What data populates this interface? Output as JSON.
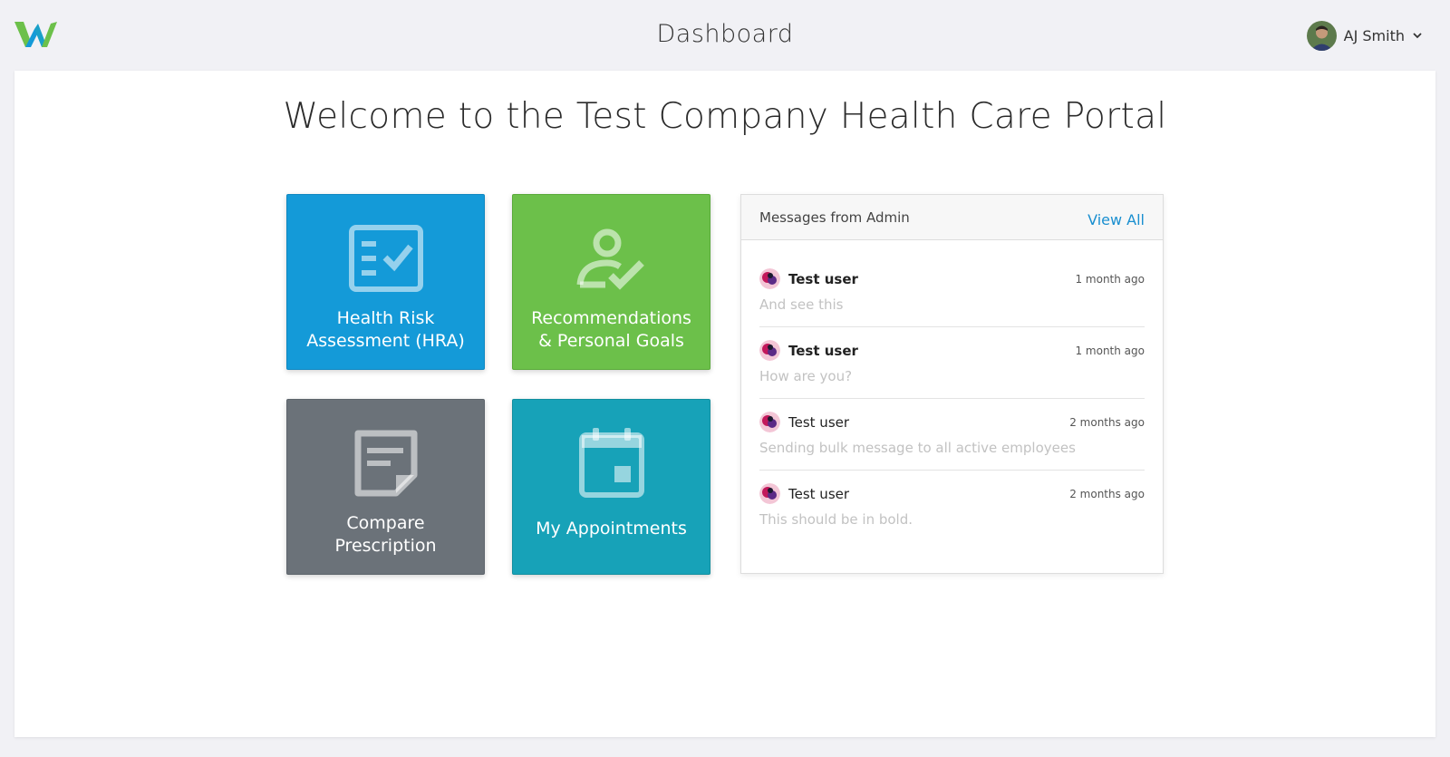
{
  "header": {
    "title": "Dashboard",
    "user_name": "AJ Smith",
    "logo_icon": "w-logo-icon",
    "brand_colors": {
      "green": "#6cc04a",
      "blue": "#149ad8"
    }
  },
  "main": {
    "welcome": "Welcome to the Test Company Health Care Portal",
    "tiles": [
      {
        "label_line1": "Health Risk",
        "label_line2": "Assessment (HRA)",
        "icon": "checklist-icon",
        "color": "#149ad8"
      },
      {
        "label_line1": "Recommendations",
        "label_line2": "& Personal Goals",
        "icon": "user-check-icon",
        "color": "#6cc04a"
      },
      {
        "label_line1": "Compare",
        "label_line2": "Prescription",
        "icon": "document-icon",
        "color": "#6b7279"
      },
      {
        "label_line1": "My Appointments",
        "icon": "calendar-icon",
        "color": "#17a2b8"
      }
    ]
  },
  "messages": {
    "title": "Messages from Admin",
    "view_all": "View All",
    "items": [
      {
        "user": "Test user",
        "time": "1 month ago",
        "preview": "And see this",
        "unread": true
      },
      {
        "user": "Test user",
        "time": "1 month ago",
        "preview": "How are you?",
        "unread": true
      },
      {
        "user": "Test user",
        "time": "2 months ago",
        "preview": "Sending bulk message to all active employees",
        "unread": false
      },
      {
        "user": "Test user",
        "time": "2 months ago",
        "preview": "This should be in bold.",
        "unread": false
      }
    ]
  }
}
